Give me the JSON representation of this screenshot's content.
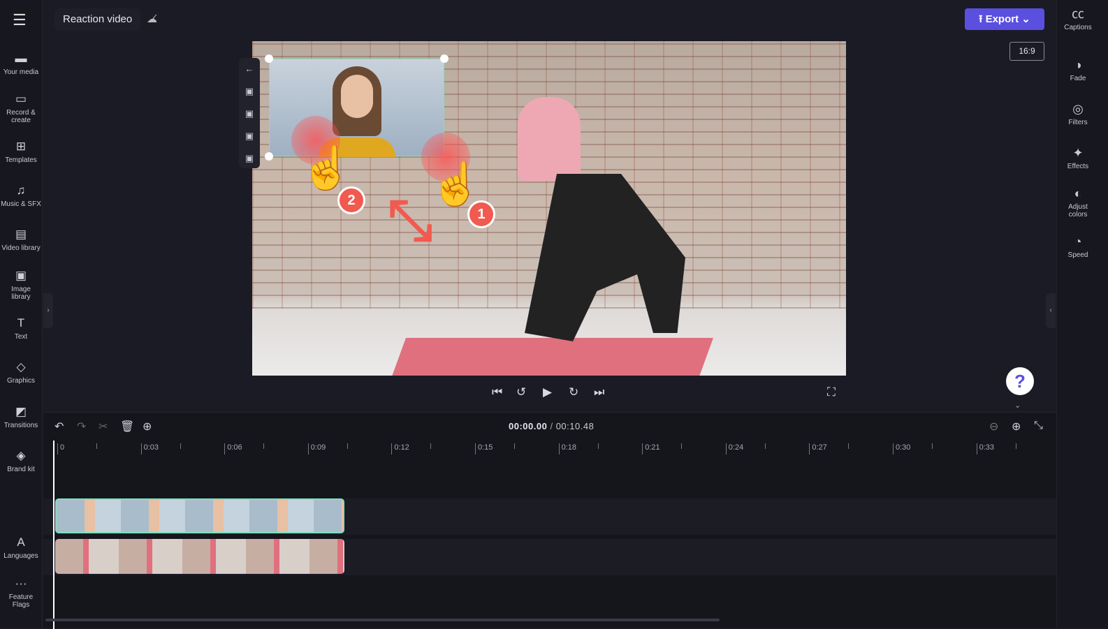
{
  "header": {
    "project_title": "Reaction video",
    "cloud_status_icon": "cloud-off-icon",
    "export_label": "Export",
    "aspect_ratio": "16:9"
  },
  "left_sidebar": {
    "items": [
      {
        "label": "Your media",
        "icon": "folder-icon"
      },
      {
        "label": "Record & create",
        "icon": "camera-icon"
      },
      {
        "label": "Templates",
        "icon": "templates-icon"
      },
      {
        "label": "Music & SFX",
        "icon": "music-icon"
      },
      {
        "label": "Video library",
        "icon": "film-icon"
      },
      {
        "label": "Image library",
        "icon": "image-icon"
      },
      {
        "label": "Text",
        "icon": "text-icon"
      },
      {
        "label": "Graphics",
        "icon": "shapes-icon"
      },
      {
        "label": "Transitions",
        "icon": "transition-icon"
      },
      {
        "label": "Brand kit",
        "icon": "brand-icon"
      },
      {
        "label": "Languages",
        "icon": "language-icon"
      },
      {
        "label": "Feature Flags",
        "icon": "more-icon"
      }
    ]
  },
  "right_sidebar": {
    "items": [
      {
        "label": "Captions",
        "icon": "cc-icon"
      },
      {
        "label": "Fade",
        "icon": "fade-icon"
      },
      {
        "label": "Filters",
        "icon": "filters-icon"
      },
      {
        "label": "Effects",
        "icon": "wand-icon"
      },
      {
        "label": "Adjust colors",
        "icon": "contrast-icon"
      },
      {
        "label": "Speed",
        "icon": "speed-icon"
      }
    ]
  },
  "annotations": {
    "step1": "1",
    "step2": "2"
  },
  "playback": {
    "current_time": "00:00.00",
    "separator": "/",
    "total_time": "00:10.48"
  },
  "timeline": {
    "ticks": [
      "0",
      "0:03",
      "0:06",
      "0:09",
      "0:12",
      "0:15",
      "0:18",
      "0:21",
      "0:24",
      "0:27",
      "0:30",
      "0:33"
    ]
  },
  "colors": {
    "accent": "#5b4fe0",
    "selection": "#7fe0c0",
    "annotation": "#f15a4f"
  }
}
